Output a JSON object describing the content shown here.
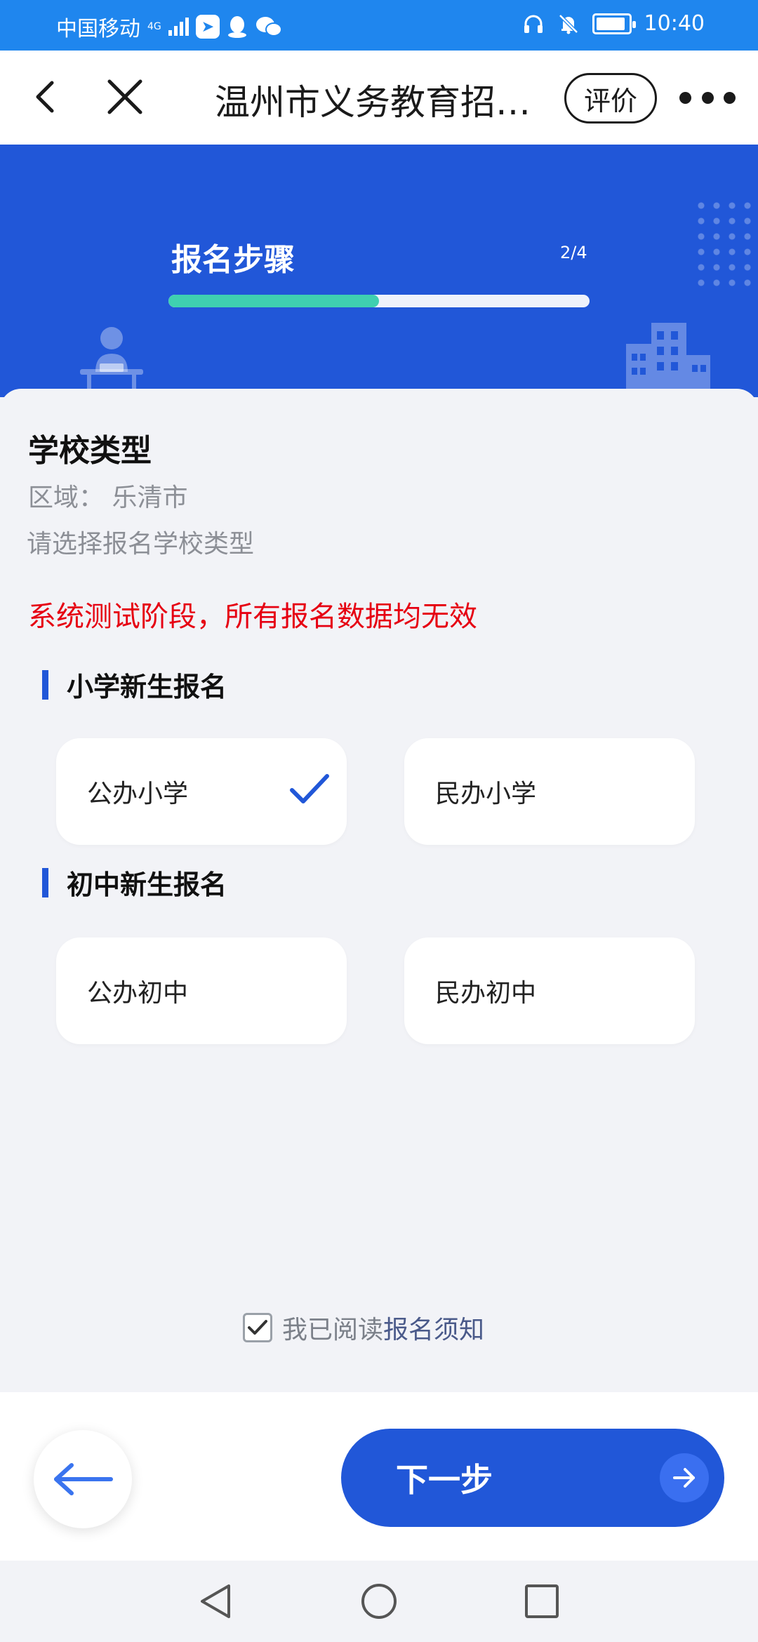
{
  "status_bar": {
    "carrier": "中国移动",
    "network": "4G",
    "time": "10:40",
    "icons": [
      "signal-icon",
      "app-notification-icon",
      "qq-icon",
      "wechat-icon",
      "headphones-icon",
      "mute-bell-icon",
      "battery-charging-icon"
    ]
  },
  "title_bar": {
    "title": "温州市义务教育招…",
    "rate_label": "评价"
  },
  "steps": {
    "title": "报名步骤",
    "count": "2/4",
    "progress": 0.5
  },
  "content": {
    "section_title": "学校类型",
    "region": "区域： 乐清市",
    "prompt": "请选择报名学校类型",
    "warning": "系统测试阶段，所有报名数据均无效",
    "groups": [
      {
        "label": "小学新生报名",
        "options": [
          {
            "label": "公办小学",
            "selected": true
          },
          {
            "label": "民办小学",
            "selected": false
          }
        ]
      },
      {
        "label": "初中新生报名",
        "options": [
          {
            "label": "公办初中",
            "selected": false
          },
          {
            "label": "民办初中",
            "selected": false
          }
        ]
      }
    ],
    "agreement": {
      "checked": true,
      "text": "我已阅读",
      "link": "报名须知"
    }
  },
  "actions": {
    "next_label": "下一步"
  },
  "colors": {
    "status_bar": "#1f86ee",
    "brand_blue": "#2157d8",
    "progress": "#3fd0b0",
    "warning": "#e60012",
    "background": "#f2f3f7"
  }
}
